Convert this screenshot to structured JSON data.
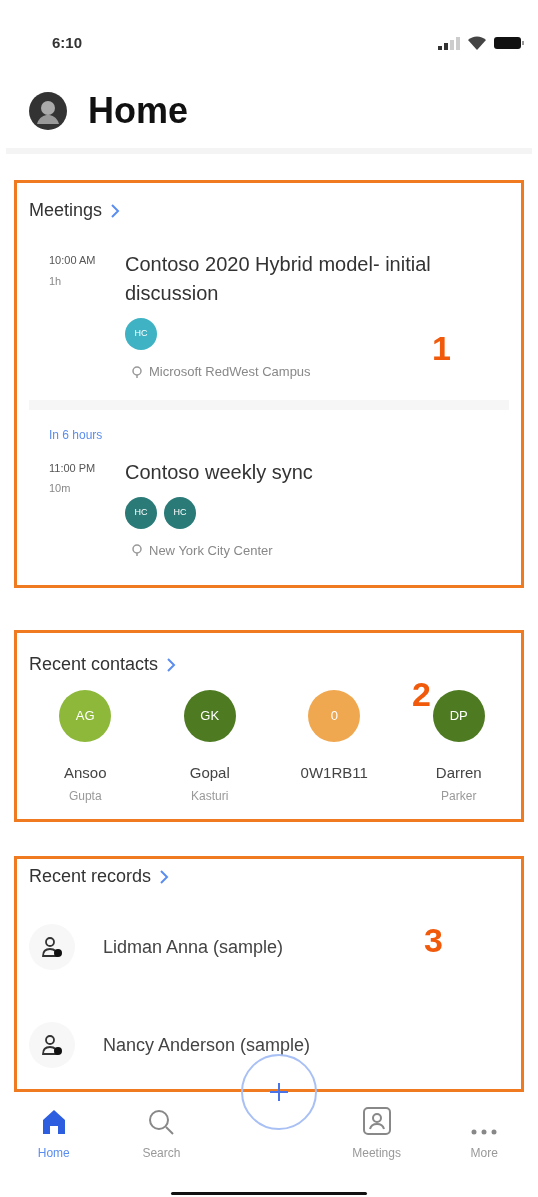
{
  "status_bar": {
    "time": "6:10"
  },
  "header": {
    "title": "Home"
  },
  "meetings": {
    "title": "Meetings",
    "callout": "1",
    "items": [
      {
        "time": "10:00 AM",
        "duration": "1h",
        "title": "Contoso 2020 Hybrid model- initial discussion",
        "attendees": [
          {
            "initials": "HC",
            "color": "#3fb3c4"
          }
        ],
        "location": "Microsoft RedWest Campus"
      },
      {
        "time": "11:00 PM",
        "duration": "10m",
        "relative": "In 6 hours",
        "title": "Contoso weekly sync",
        "attendees": [
          {
            "initials": "HC",
            "color": "#2a7a78"
          },
          {
            "initials": "HC",
            "color": "#2a7a78"
          }
        ],
        "location": "New York City Center"
      }
    ]
  },
  "contacts": {
    "title": "Recent contacts",
    "callout": "2",
    "items": [
      {
        "initials": "AG",
        "color": "#8db83a",
        "first": "Ansoo",
        "last": "Gupta"
      },
      {
        "initials": "GK",
        "color": "#4e7a22",
        "first": "Gopal",
        "last": "Kasturi"
      },
      {
        "initials": "0",
        "color": "#f0a850",
        "first": "0W1RB11"
      },
      {
        "initials": "DP",
        "color": "#4e7a22",
        "first": "Darren",
        "last": "Parker"
      }
    ]
  },
  "records": {
    "title": "Recent records",
    "callout": "3",
    "items": [
      {
        "name": "Lidman Anna (sample)"
      },
      {
        "name": "Nancy Anderson (sample)"
      }
    ]
  },
  "nav": [
    {
      "label": "Home",
      "kind": "home",
      "selected": true
    },
    {
      "label": "Search",
      "kind": "search",
      "selected": false
    },
    {
      "label": "Meetings",
      "kind": "meetings",
      "selected": false
    },
    {
      "label": "More",
      "kind": "more",
      "selected": false
    }
  ]
}
